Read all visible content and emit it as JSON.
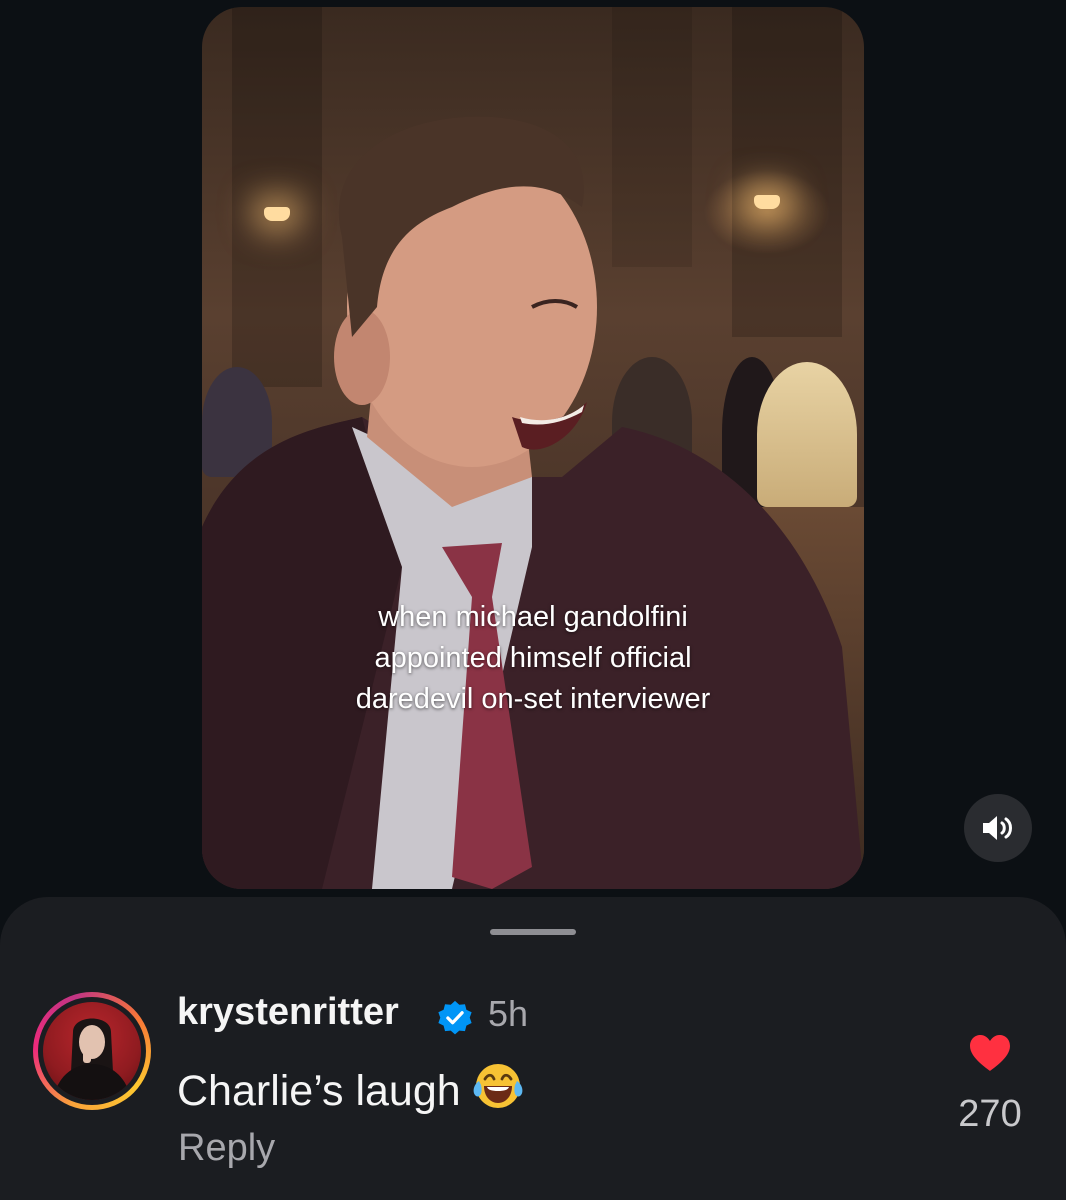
{
  "video": {
    "caption_lines": [
      "when michael gandolfini",
      "appointed himself official",
      "daredevil on-set interviewer"
    ],
    "mute_icon": "speaker-sound-icon"
  },
  "comment": {
    "username": "krystenritter",
    "verified": true,
    "time": "5h",
    "text": "Charlie’s laugh",
    "emoji": "😂",
    "reply_label": "Reply",
    "like_count": "270",
    "colors": {
      "heart": "#ff3040",
      "verified": "#0095f6",
      "sheet_bg": "#1b1d21",
      "page_bg": "#0c1014"
    }
  }
}
